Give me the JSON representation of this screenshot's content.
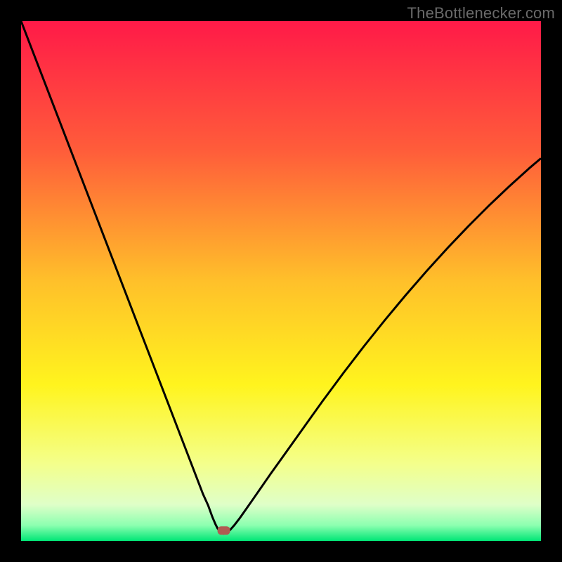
{
  "watermark": "TheBottlenecker.com",
  "chart_data": {
    "type": "line",
    "title": "",
    "xlabel": "",
    "ylabel": "",
    "xlim": [
      0,
      100
    ],
    "ylim": [
      0,
      100
    ],
    "grid": false,
    "legend": false,
    "background_gradient": {
      "stops": [
        {
          "offset": 0.0,
          "color": "#ff1a48"
        },
        {
          "offset": 0.25,
          "color": "#ff5d3a"
        },
        {
          "offset": 0.5,
          "color": "#ffc02a"
        },
        {
          "offset": 0.7,
          "color": "#fff41e"
        },
        {
          "offset": 0.85,
          "color": "#f4ff8a"
        },
        {
          "offset": 0.93,
          "color": "#dfffc8"
        },
        {
          "offset": 0.97,
          "color": "#8cffb0"
        },
        {
          "offset": 1.0,
          "color": "#00e676"
        }
      ]
    },
    "marker": {
      "x": 39.0,
      "y": 2.0,
      "color": "#b15a52"
    },
    "series": [
      {
        "name": "curve",
        "color": "#000000",
        "x": [
          0,
          2,
          4,
          6,
          8,
          10,
          12,
          14,
          16,
          18,
          20,
          22,
          24,
          26,
          28,
          30,
          32,
          34,
          35,
          36,
          36.8,
          37.4,
          37.8,
          38.1,
          38.4,
          38.7,
          39.0,
          39.6,
          40.2,
          41.0,
          42.0,
          43.2,
          44.6,
          46.2,
          48.0,
          50,
          52,
          54,
          56,
          58,
          60,
          62,
          64,
          66,
          68,
          70,
          72,
          74,
          76,
          78,
          80,
          82,
          84,
          86,
          88,
          90,
          92,
          94,
          96,
          98,
          100
        ],
        "y": [
          100,
          94.8,
          89.6,
          84.4,
          79.2,
          74.0,
          68.8,
          63.6,
          58.4,
          53.2,
          48.0,
          42.8,
          37.6,
          32.4,
          27.2,
          22.0,
          16.8,
          11.6,
          9.0,
          6.8,
          4.6,
          3.2,
          2.4,
          2.0,
          1.7,
          1.5,
          1.4,
          1.6,
          2.1,
          3.0,
          4.3,
          6.0,
          8.0,
          10.3,
          12.9,
          15.7,
          18.5,
          21.3,
          24.1,
          26.9,
          29.6,
          32.3,
          34.9,
          37.5,
          40.0,
          42.5,
          44.9,
          47.3,
          49.6,
          51.9,
          54.1,
          56.3,
          58.4,
          60.5,
          62.5,
          64.5,
          66.4,
          68.3,
          70.1,
          71.9,
          73.6
        ]
      }
    ]
  }
}
